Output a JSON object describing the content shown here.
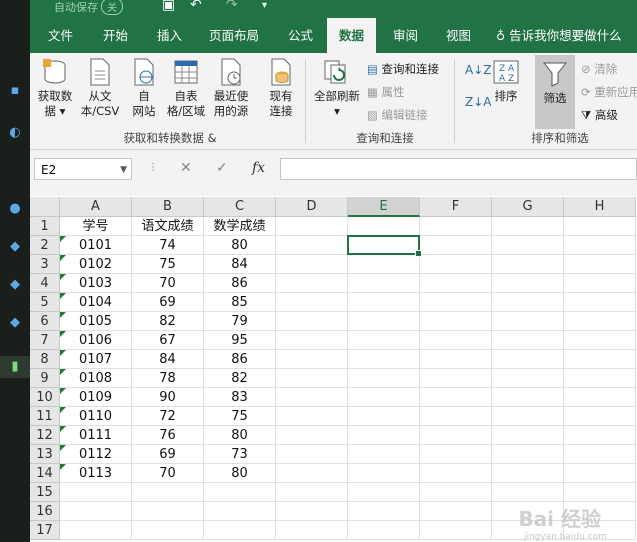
{
  "titlebar": {
    "autosave_label": "自动保存",
    "autosave_state": "关"
  },
  "tabs": [
    {
      "label": "文件"
    },
    {
      "label": "开始"
    },
    {
      "label": "插入"
    },
    {
      "label": "页面布局"
    },
    {
      "label": "公式"
    },
    {
      "label": "数据",
      "active": true
    },
    {
      "label": "审阅"
    },
    {
      "label": "视图"
    }
  ],
  "tell_me": "告诉我你想要做什么",
  "ribbon": {
    "get_transform": {
      "group_label": "获取和转换数据",
      "buttons": [
        {
          "line1": "获取数",
          "line2": "据 ▾"
        },
        {
          "line1": "从文",
          "line2": "本/CSV"
        },
        {
          "line1": "自",
          "line2": "网站"
        },
        {
          "line1": "自表",
          "line2": "格/区域"
        },
        {
          "line1": "最近使",
          "line2": "用的源"
        },
        {
          "line1": "现有",
          "line2": "连接"
        }
      ]
    },
    "queries": {
      "group_label": "查询和连接",
      "refresh_line1": "全部刷新",
      "refresh_line2": "▾",
      "queries_connections": "查询和连接",
      "properties": "属性",
      "edit_links": "编辑链接"
    },
    "sort_filter": {
      "group_label": "排序和筛选",
      "sort": "排序",
      "filter": "筛选",
      "clear": "清除",
      "reapply": "重新应用",
      "advanced": "高级"
    }
  },
  "formula_bar": {
    "name_box": "E2",
    "cancel": "✕",
    "enter": "✓",
    "fx": "fx",
    "formula": ""
  },
  "columns": [
    "A",
    "B",
    "C",
    "D",
    "E",
    "F",
    "G",
    "H"
  ],
  "selected_column": "E",
  "rows": [
    [
      "学号",
      "语文成绩",
      "数学成绩"
    ],
    [
      "0101",
      "74",
      "80"
    ],
    [
      "0102",
      "75",
      "84"
    ],
    [
      "0103",
      "70",
      "86"
    ],
    [
      "0104",
      "69",
      "85"
    ],
    [
      "0105",
      "82",
      "79"
    ],
    [
      "0106",
      "67",
      "95"
    ],
    [
      "0107",
      "84",
      "86"
    ],
    [
      "0108",
      "78",
      "82"
    ],
    [
      "0109",
      "90",
      "83"
    ],
    [
      "0110",
      "72",
      "75"
    ],
    [
      "0111",
      "76",
      "80"
    ],
    [
      "0112",
      "69",
      "73"
    ],
    [
      "0113",
      "70",
      "80"
    ],
    [
      "",
      "",
      ""
    ],
    [
      "",
      "",
      ""
    ],
    [
      "",
      "",
      ""
    ]
  ],
  "row_numbers": [
    "1",
    "2",
    "3",
    "4",
    "5",
    "6",
    "7",
    "8",
    "9",
    "10",
    "11",
    "12",
    "13",
    "14",
    "15",
    "16",
    "17"
  ],
  "selected_cell": "E2",
  "watermark": "Bai 经验",
  "watermark_sub": "jingyan.baidu.com",
  "colors": {
    "accent": "#217346",
    "text_marker": "#1e7b3c"
  }
}
